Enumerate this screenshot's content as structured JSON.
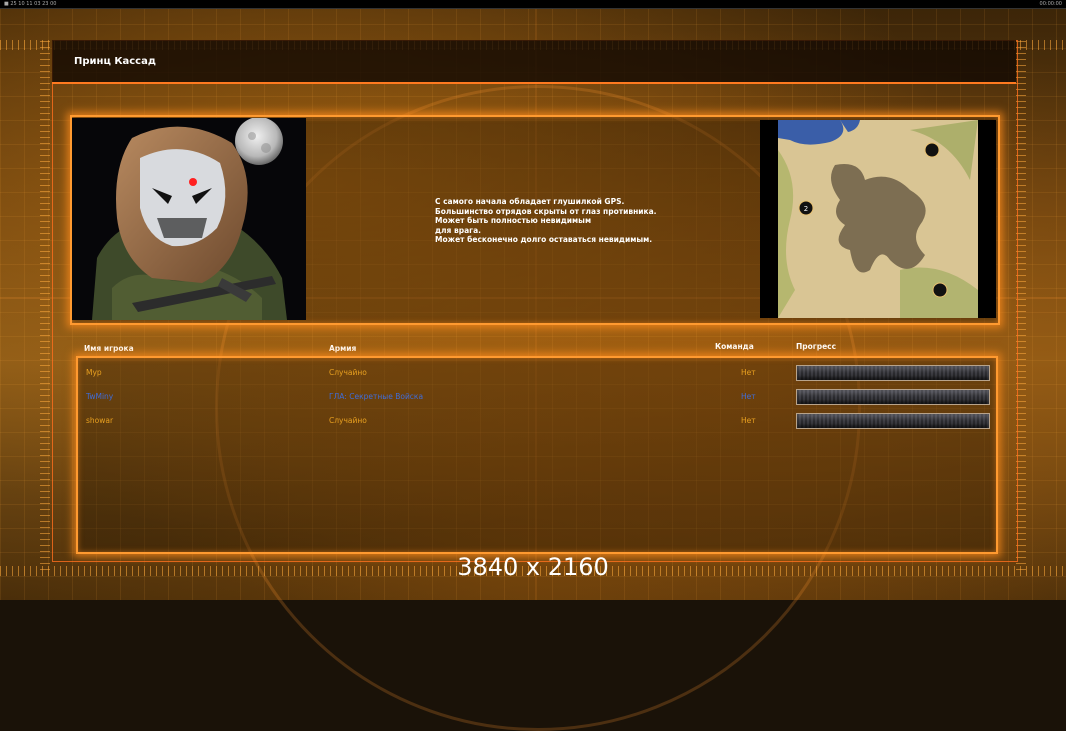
{
  "window": {
    "status_left": "■ 25 10 11 03 23 00",
    "status_right": "00:00:00"
  },
  "faction": {
    "title": "Принц Кассад"
  },
  "description": [
    "С самого начала обладает глушилкой GPS.",
    "Большинство отрядов скрыты от глаз противника.",
    "Может быть полностью невидимым",
    "для врага.",
    "Может бесконечно долго оставаться невидимым."
  ],
  "minimap": {
    "player_marker": "2"
  },
  "table": {
    "headers": {
      "player": "Имя игрока",
      "army": "Армия",
      "team": "Команда",
      "progress": "Прогресс"
    },
    "rows": [
      {
        "player": "Myp",
        "army": "Случайно",
        "team": "Нет",
        "progress": 0,
        "color": "#e8a020"
      },
      {
        "player": "TwMiny",
        "army": "ГЛА: Секретные Войска",
        "team": "Нет",
        "progress": 0,
        "color": "#3f6cd8"
      },
      {
        "player": "showar",
        "army": "Случайно",
        "team": "Нет",
        "progress": 0,
        "color": "#e8a020"
      }
    ]
  },
  "overlay": {
    "resolution": "3840 x 2160"
  },
  "colors": {
    "accent": "#ff9a30",
    "frame": "#ff7a20"
  }
}
